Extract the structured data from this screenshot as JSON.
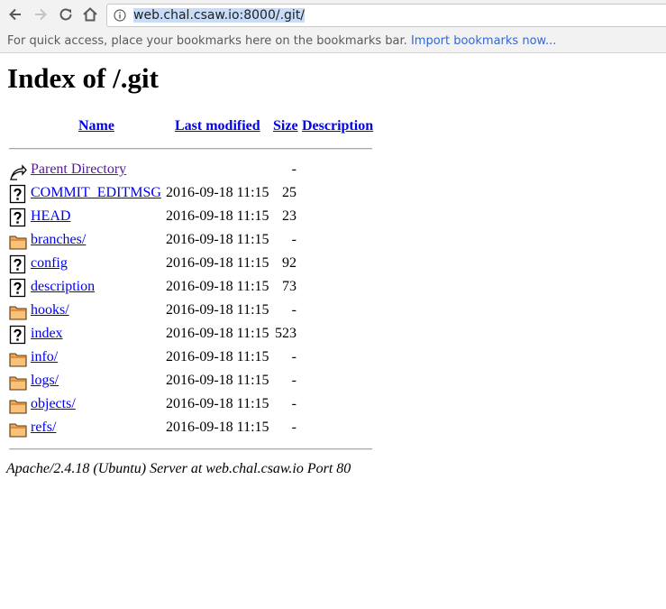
{
  "browser": {
    "url": "web.chal.csaw.io:8000/.git/",
    "bookmarks_message": "For quick access, place your bookmarks here on the bookmarks bar.",
    "import_bookmarks": "Import bookmarks now..."
  },
  "page": {
    "title": "Index of /.git",
    "columns": {
      "name": "Name",
      "last_modified": "Last modified",
      "size": "Size",
      "description": "Description"
    },
    "parent": {
      "name": "Parent Directory",
      "size": "-"
    },
    "entries": [
      {
        "name": "COMMIT_EDITMSG",
        "modified": "2016-09-18 11:15",
        "size": "25",
        "icon": "unknown-file-icon"
      },
      {
        "name": "HEAD",
        "modified": "2016-09-18 11:15",
        "size": "23",
        "icon": "unknown-file-icon"
      },
      {
        "name": "branches/",
        "modified": "2016-09-18 11:15",
        "size": "-",
        "icon": "folder-icon"
      },
      {
        "name": "config",
        "modified": "2016-09-18 11:15",
        "size": "92",
        "icon": "unknown-file-icon"
      },
      {
        "name": "description",
        "modified": "2016-09-18 11:15",
        "size": "73",
        "icon": "unknown-file-icon"
      },
      {
        "name": "hooks/",
        "modified": "2016-09-18 11:15",
        "size": "-",
        "icon": "folder-icon"
      },
      {
        "name": "index",
        "modified": "2016-09-18 11:15",
        "size": "523",
        "icon": "unknown-file-icon"
      },
      {
        "name": "info/",
        "modified": "2016-09-18 11:15",
        "size": "-",
        "icon": "folder-icon"
      },
      {
        "name": "logs/",
        "modified": "2016-09-18 11:15",
        "size": "-",
        "icon": "folder-icon"
      },
      {
        "name": "objects/",
        "modified": "2016-09-18 11:15",
        "size": "-",
        "icon": "folder-icon"
      },
      {
        "name": "refs/",
        "modified": "2016-09-18 11:15",
        "size": "-",
        "icon": "folder-icon"
      }
    ],
    "footer": "Apache/2.4.18 (Ubuntu) Server at web.chal.csaw.io Port 80"
  },
  "colors": {
    "link": "#0000ee",
    "visited_link": "#551a8b",
    "import_link": "#3367d6",
    "url_selection": "#c6dcf9"
  }
}
